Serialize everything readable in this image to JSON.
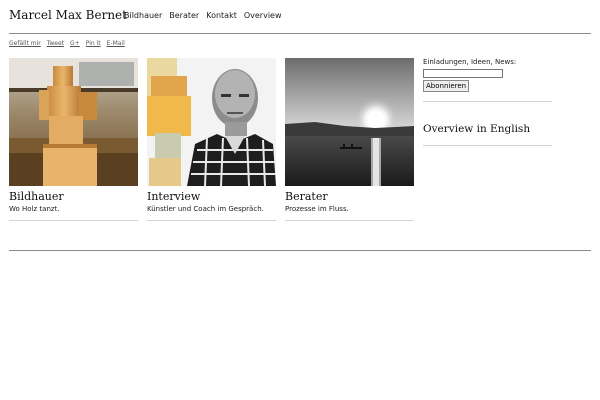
{
  "site": {
    "title": "Marcel Max Bernet"
  },
  "nav": {
    "items": [
      "Bildhauer",
      "Berater",
      "Kontakt",
      "Overview"
    ]
  },
  "share": {
    "items": [
      "Gefällt mir",
      "Tweet",
      "G+",
      "Pin it",
      "E-Mail"
    ]
  },
  "cards": [
    {
      "title": "Bildhauer",
      "subtitle": "Wo Holz tanzt."
    },
    {
      "title": "Interview",
      "subtitle": "Künstler und Coach im Gespräch."
    },
    {
      "title": "Berater",
      "subtitle": "Prozesse im Fluss."
    }
  ],
  "sidebar": {
    "newsletter_label": "Einladungen, Ideen, News:",
    "email_value": "",
    "subscribe_label": "Abonnieren",
    "overview_link": "Overview in English"
  }
}
